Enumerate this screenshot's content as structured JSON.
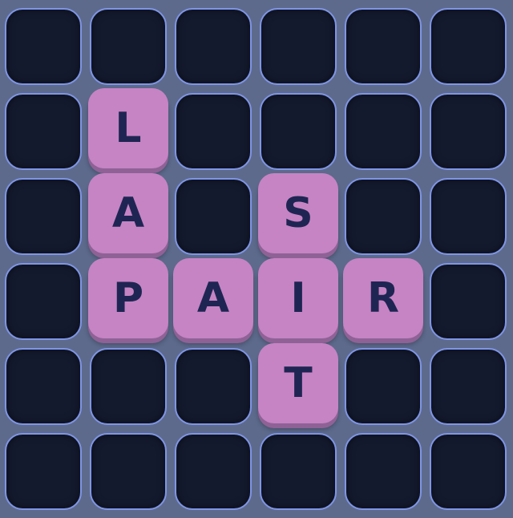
{
  "board": {
    "rows": 6,
    "cols": 6,
    "colors": {
      "background": "#5d6a8c",
      "empty_cell": "#141a2e",
      "empty_cell_border": "#7f95e6",
      "tile": "#c684c4",
      "tile_shadow": "#8f6296",
      "letter": "#1f2552"
    },
    "tiles": [
      {
        "row": 1,
        "col": 1,
        "letter": "L"
      },
      {
        "row": 2,
        "col": 1,
        "letter": "A"
      },
      {
        "row": 2,
        "col": 3,
        "letter": "S"
      },
      {
        "row": 3,
        "col": 1,
        "letter": "P"
      },
      {
        "row": 3,
        "col": 2,
        "letter": "A"
      },
      {
        "row": 3,
        "col": 3,
        "letter": "I"
      },
      {
        "row": 3,
        "col": 4,
        "letter": "R"
      },
      {
        "row": 4,
        "col": 3,
        "letter": "T"
      }
    ]
  }
}
